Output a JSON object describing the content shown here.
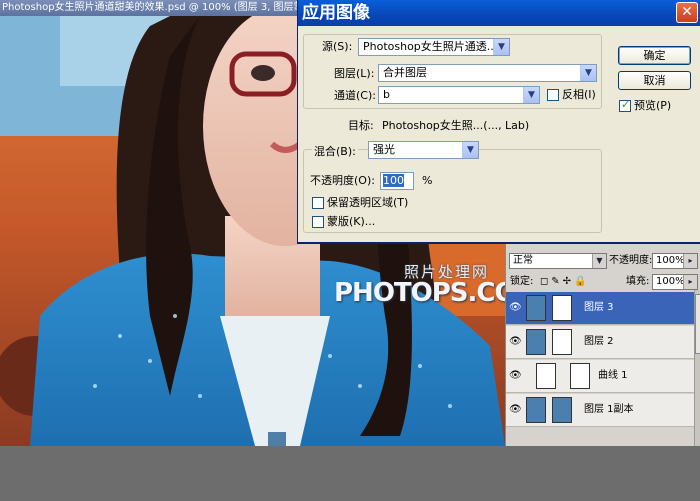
{
  "document": {
    "title": "Photoshop女生照片通道甜美的效果.psd @ 100% (图层 3, 图层蒙"
  },
  "watermark": {
    "cn": "照片处理网",
    "en": "PHOTOPS.COM"
  },
  "dialog": {
    "title": "应用图像",
    "close_symbol": "✕",
    "source_label": "源(S):",
    "source_value": "Photoshop女生照片通透...",
    "layer_label": "图层(L):",
    "layer_value": "合并图层",
    "channel_label": "通道(C):",
    "channel_value": "b",
    "invert_label": "反相(I)",
    "invert_checked": false,
    "target_label": "目标:",
    "target_value": "Photoshop女生照...(..., Lab)",
    "blend_label": "混合(B):",
    "blend_value": "强光",
    "opacity_label": "不透明度(O):",
    "opacity_value": "100",
    "opacity_unit": "%",
    "preserve_label": "保留透明区域(T)",
    "preserve_checked": false,
    "mask_label": "蒙版(K)...",
    "mask_checked": false,
    "ok_label": "确定",
    "cancel_label": "取消",
    "preview_label": "预览(P)",
    "preview_checked": true
  },
  "layers_panel": {
    "blend_mode": "正常",
    "opacity_label": "不透明度:",
    "opacity_value": "100%",
    "lock_label": "锁定:",
    "fill_label": "填充:",
    "fill_value": "100%",
    "layers": [
      {
        "name": "图层 3",
        "selected": true,
        "has_mask": true
      },
      {
        "name": "图层 2",
        "selected": false,
        "has_mask": true
      },
      {
        "name": "曲线 1",
        "selected": false,
        "adjustment": true
      },
      {
        "name": "图层 1副本",
        "selected": false,
        "has_mask": true
      }
    ]
  },
  "colors": {
    "dialog_title_blue": "#0846b8",
    "selected_layer_blue": "#3a64b8",
    "dialog_face": "#ece9d8"
  }
}
